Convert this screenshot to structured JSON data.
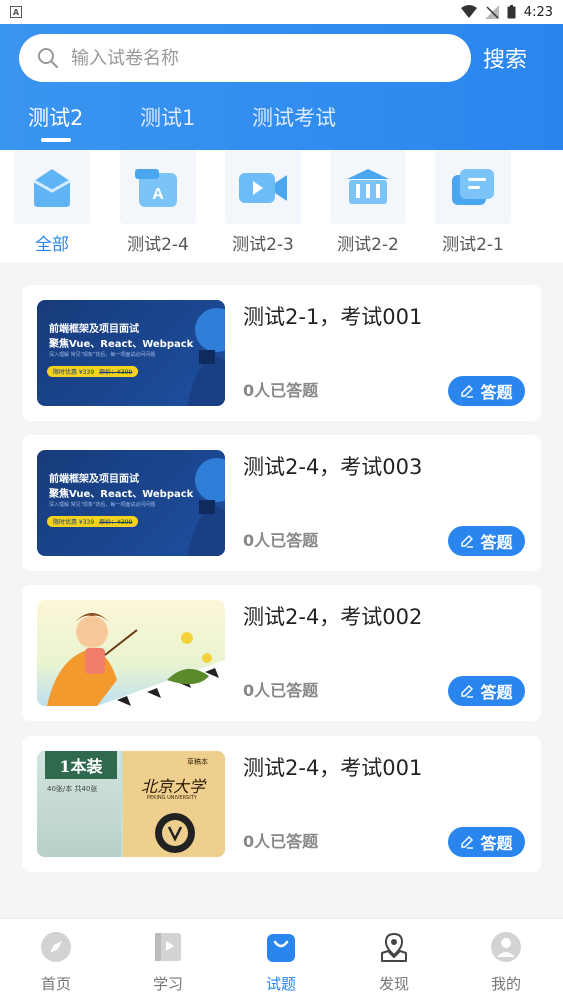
{
  "status_bar": {
    "time": "4:23"
  },
  "search": {
    "placeholder": "输入试卷名称",
    "button_label": "搜索"
  },
  "tabs": [
    {
      "label": "测试2",
      "active": true
    },
    {
      "label": "测试1",
      "active": false
    },
    {
      "label": "测试考试",
      "active": false
    }
  ],
  "categories": [
    {
      "label": "全部",
      "icon": "folder-icon",
      "active": true
    },
    {
      "label": "测试2-4",
      "icon": "document-a-icon",
      "active": false
    },
    {
      "label": "测试2-3",
      "icon": "video-camera-icon",
      "active": false
    },
    {
      "label": "测试2-2",
      "icon": "bank-icon",
      "active": false
    },
    {
      "label": "测试2-1",
      "icon": "card-icon",
      "active": false
    }
  ],
  "exams": [
    {
      "title": "测试2-1，考试001",
      "count": "0人已答题",
      "button": "答题",
      "thumb": {
        "line1": "前端框架及项目面试",
        "line2": "聚焦Vue、React、Webpack",
        "line3": "深入理解 常见\"现象\"背后，每一项面试必问问题",
        "price": "限时优惠 ¥339",
        "old_price": "原价：¥399"
      }
    },
    {
      "title": "测试2-4，考试003",
      "count": "0人已答题",
      "button": "答题",
      "thumb": {
        "line1": "前端框架及项目面试",
        "line2": "聚焦Vue、React、Webpack",
        "line3": "深入理解 常见\"现象\"背后，每一项面试必问问题",
        "price": "限时优惠 ¥339",
        "old_price": "原价：¥399"
      }
    },
    {
      "title": "测试2-4，考试002",
      "count": "0人已答题",
      "button": "答题",
      "thumb": {}
    },
    {
      "title": "测试2-4，考试001",
      "count": "0人已答题",
      "button": "答题",
      "thumb": {
        "badge": "1本装",
        "sub": "40张/本  共40张",
        "brand": "草稿本",
        "school_cn": "北京大学",
        "school_en": "PEKING UNIVERSITY"
      }
    }
  ],
  "tabbar": [
    {
      "label": "首页",
      "icon": "compass-icon",
      "active": false
    },
    {
      "label": "学习",
      "icon": "book-icon",
      "active": false
    },
    {
      "label": "试题",
      "icon": "bag-icon",
      "active": true
    },
    {
      "label": "发现",
      "icon": "map-pin-icon",
      "active": false
    },
    {
      "label": "我的",
      "icon": "user-icon",
      "active": false
    }
  ],
  "colors": {
    "primary": "#2a86ee",
    "header_gradient_start": "#3a95f0"
  }
}
